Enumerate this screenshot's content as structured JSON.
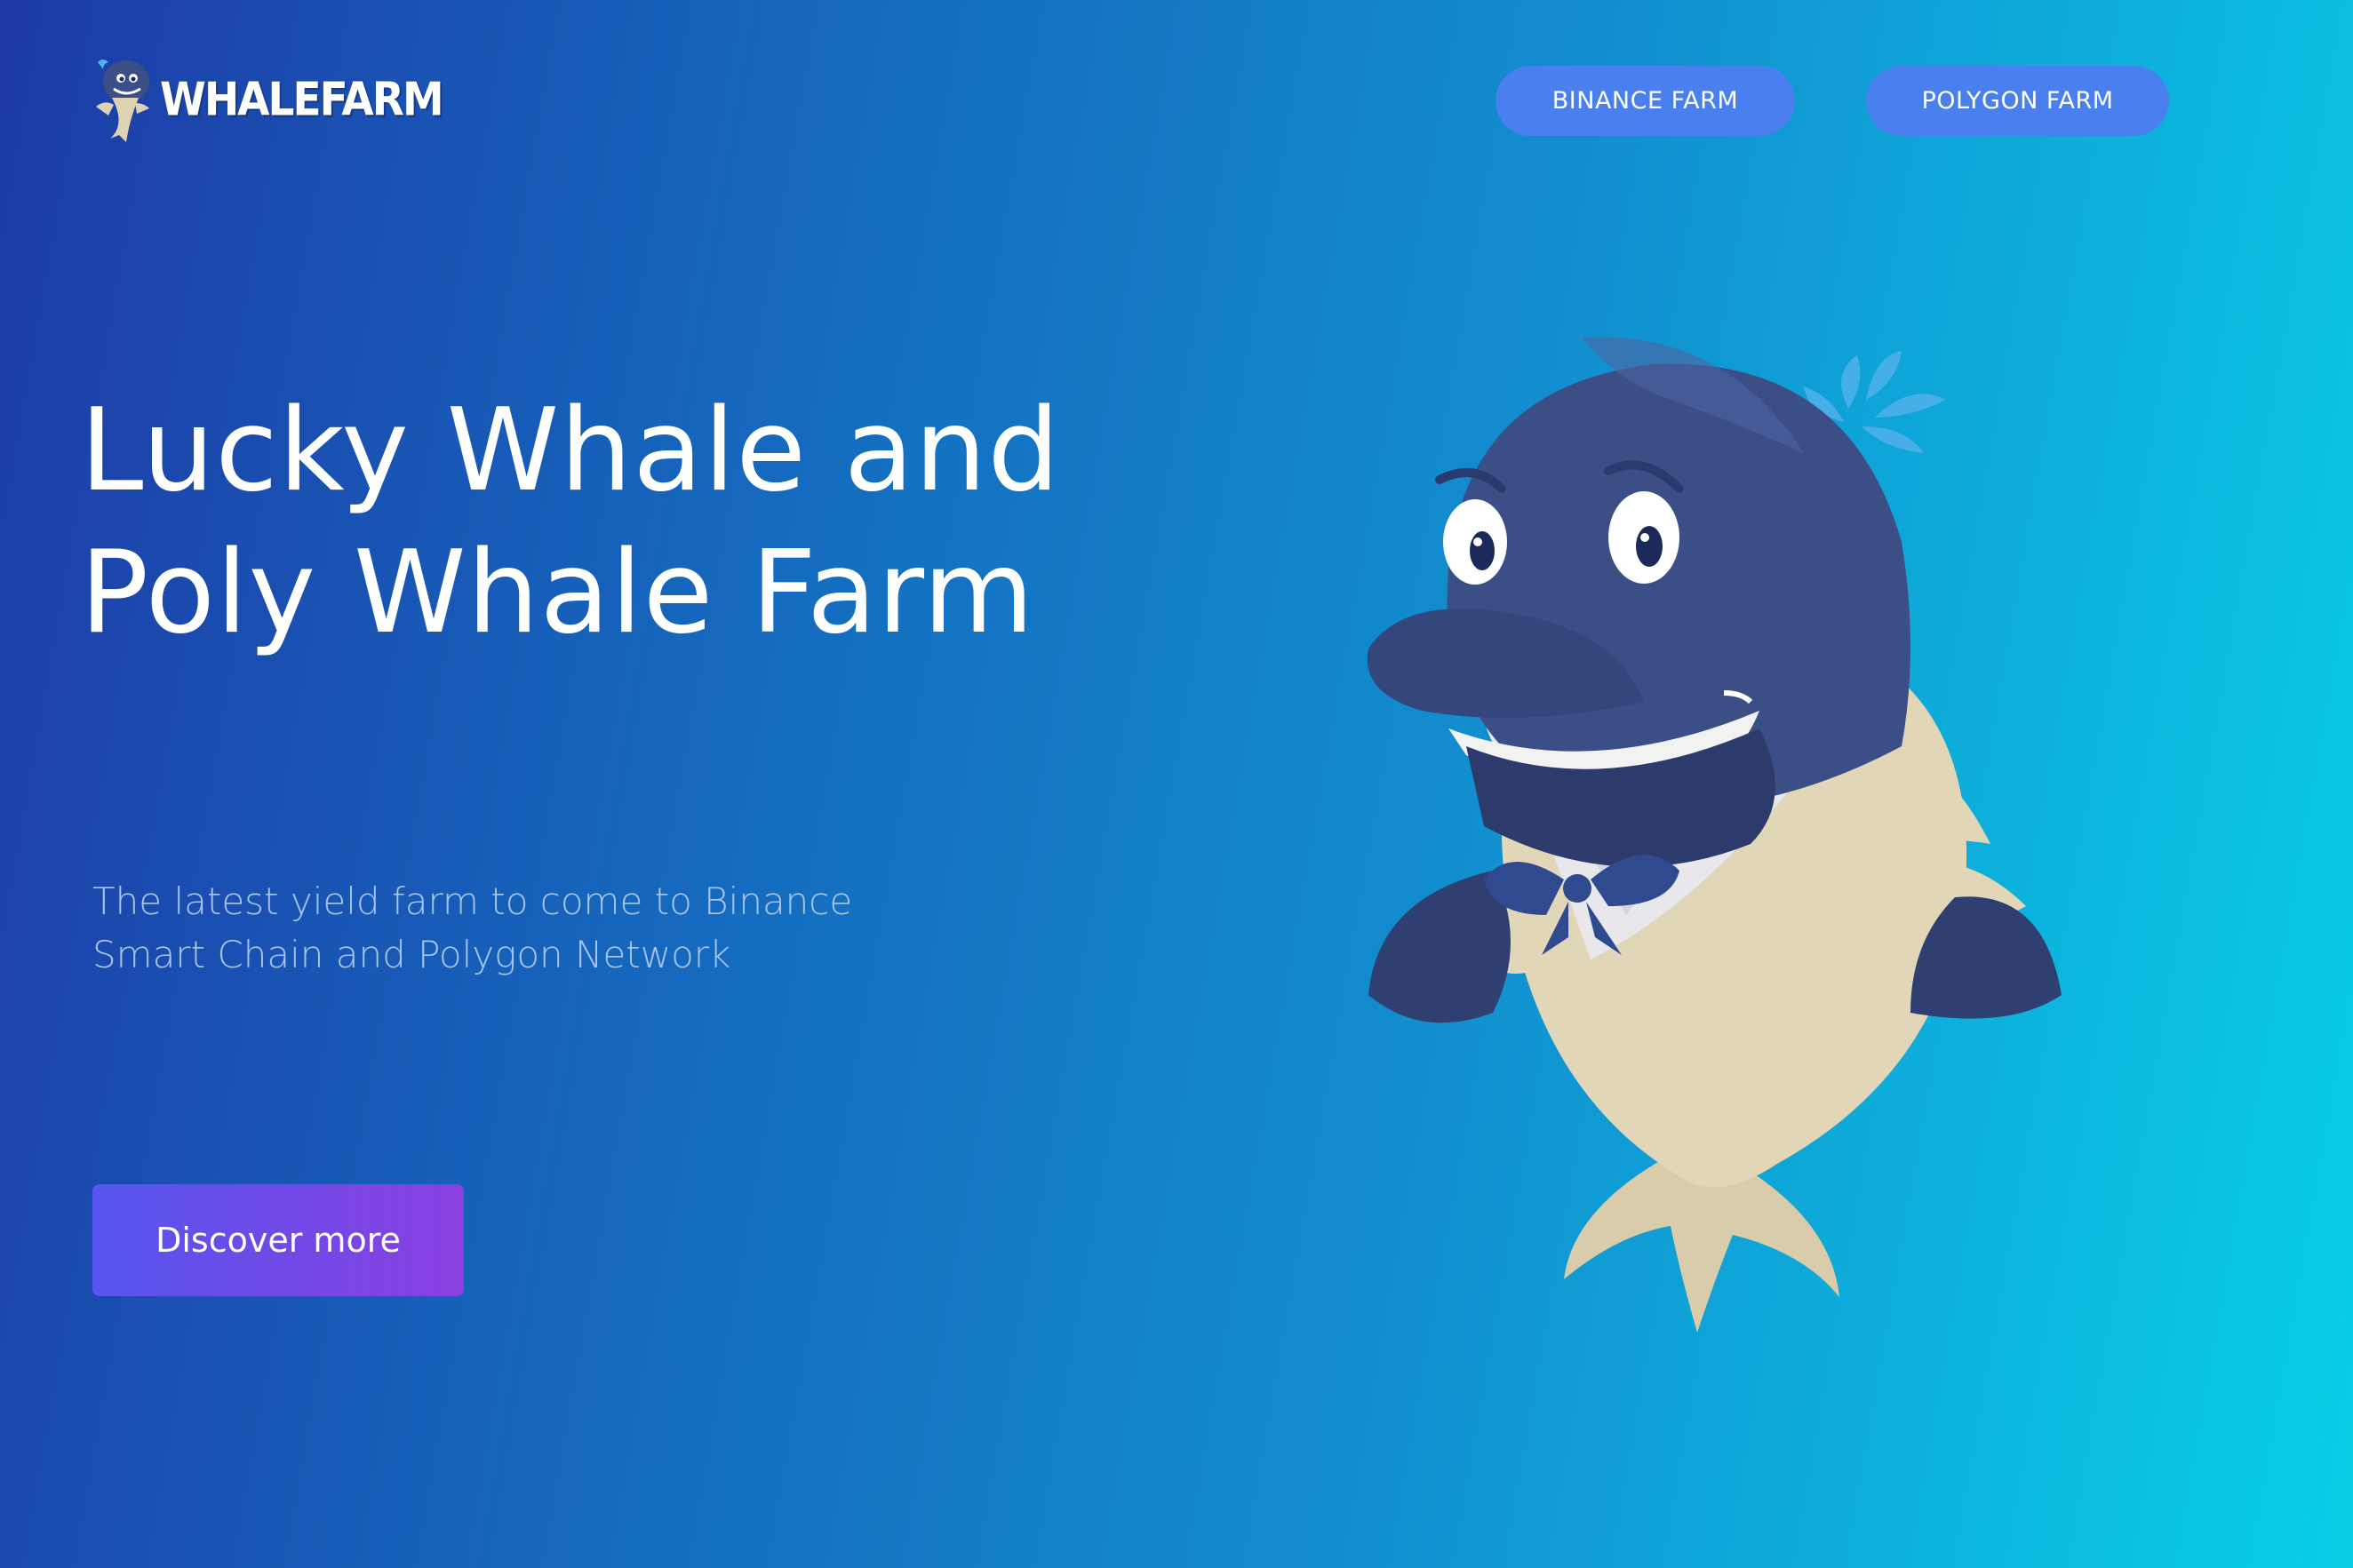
{
  "brand": {
    "name": "WHALEFARM"
  },
  "nav": {
    "binance_label": "BINANCE FARM",
    "polygon_label": "POLYGON FARM"
  },
  "hero": {
    "title_line1": "Lucky Whale and",
    "title_line2": "Poly Whale Farm",
    "subtitle_line1": "The latest yield farm to come to Binance",
    "subtitle_line2": "Smart Chain and Polygon Network",
    "cta_label": "Discover more"
  },
  "icons": {
    "logo": "whale-mascot-icon",
    "illustration": "whale-mascot-illustration"
  },
  "colors": {
    "background_start": "#1e3aa6",
    "background_end": "#08cfe8",
    "nav_button": "#4a7ff0",
    "cta_start": "#5555ef",
    "cta_end": "#8a3fe0",
    "whale_body": "#3b4f86",
    "whale_belly": "#dfd2b2"
  }
}
